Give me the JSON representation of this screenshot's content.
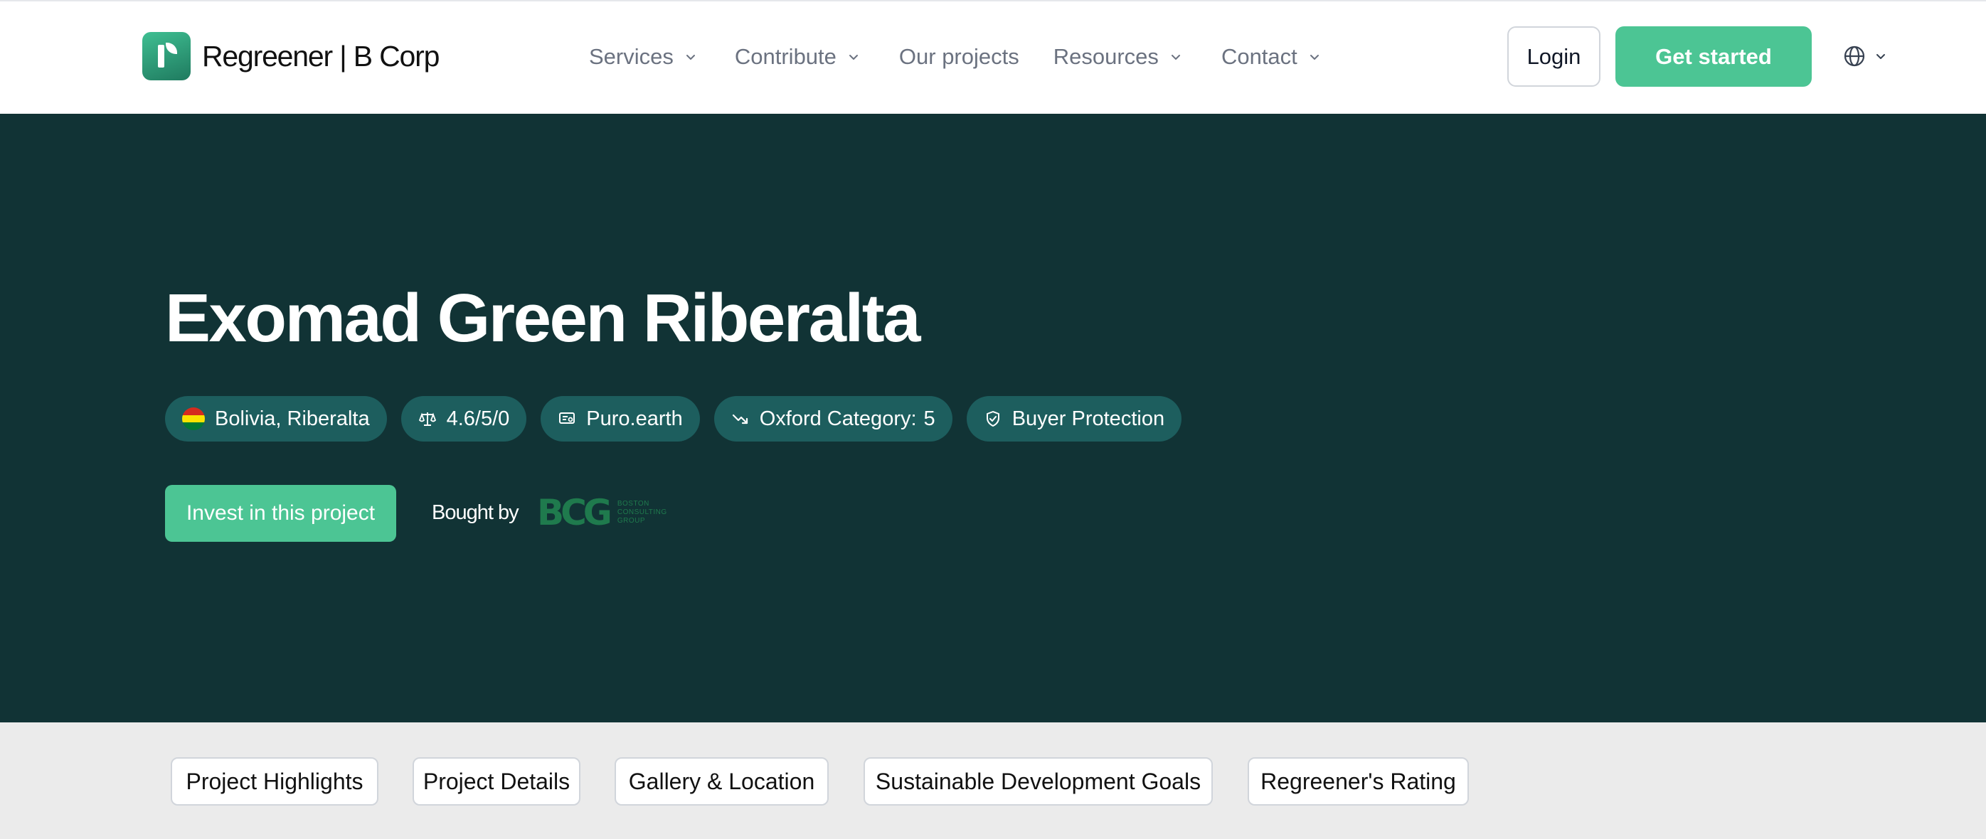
{
  "header": {
    "logo_text": "Regreener | B Corp",
    "nav": [
      {
        "label": "Services",
        "has_dropdown": true
      },
      {
        "label": "Contribute",
        "has_dropdown": true
      },
      {
        "label": "Our projects",
        "has_dropdown": false
      },
      {
        "label": "Resources",
        "has_dropdown": true
      },
      {
        "label": "Contact",
        "has_dropdown": true
      }
    ],
    "login_label": "Login",
    "get_started_label": "Get started",
    "language_icon": "globe-icon"
  },
  "hero": {
    "title": "Exomad Green Riberalta",
    "chips": {
      "location": "Bolivia, Riberalta",
      "rating": "4.6/5/0",
      "registry": "Puro.earth",
      "oxford_label": "Oxford Category:",
      "oxford_value": "5",
      "protection": "Buyer Protection"
    },
    "invest_label": "Invest in this project",
    "bought_by_label": "Bought by",
    "buyer_logo": {
      "mark": "BCG",
      "line1": "BOSTON",
      "line2": "CONSULTING",
      "line3": "GROUP"
    }
  },
  "tabs": [
    "Project Highlights",
    "Project Details",
    "Gallery & Location",
    "Sustainable Development Goals",
    "Regreener's Rating"
  ],
  "colors": {
    "hero_bg": "#113335",
    "chip_bg": "#1d5e5e",
    "accent_green": "#4cc594",
    "tabs_bg": "#ebebeb",
    "flag_red": "#d52b1e",
    "flag_yellow": "#f9e300",
    "flag_green": "#007934"
  }
}
